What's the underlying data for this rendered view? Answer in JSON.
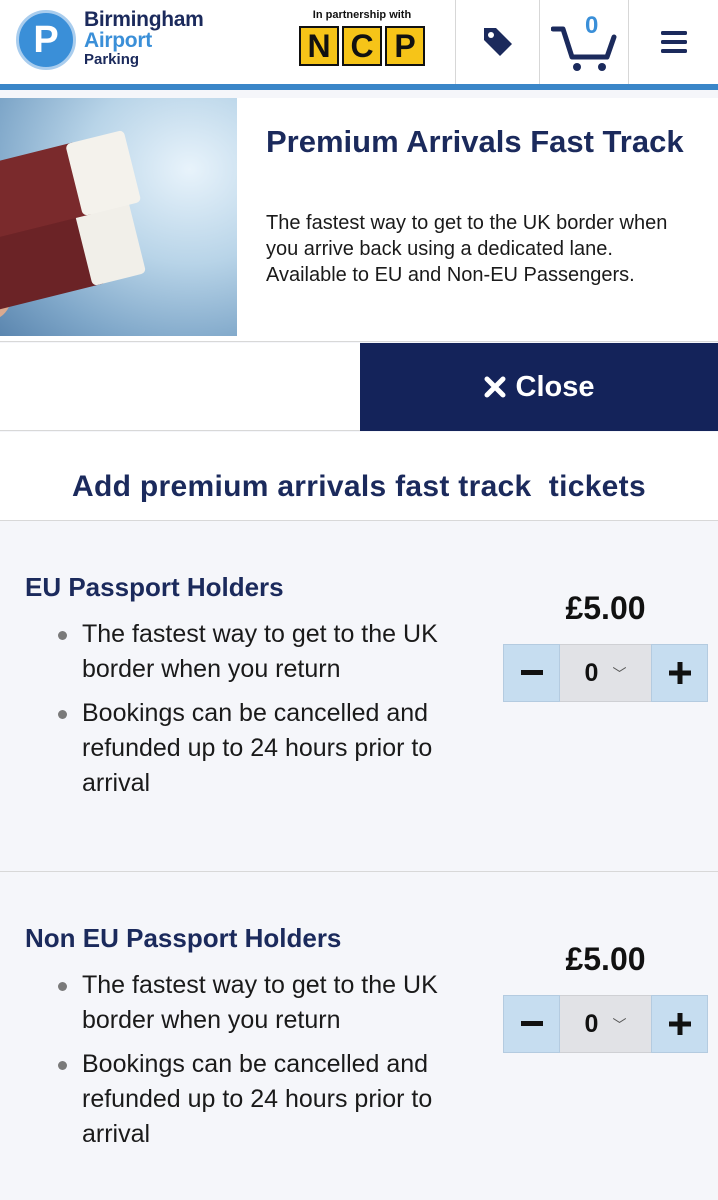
{
  "header": {
    "logo_line1": "Birmingham",
    "logo_line2": "Airport",
    "logo_line3": "Parking",
    "logo_letter": "P",
    "partner_text": "In partnership with",
    "partner_letters": [
      "N",
      "C",
      "P"
    ],
    "cart_count": "0",
    "icons": [
      "tag-icon",
      "cart-icon",
      "menu-icon"
    ]
  },
  "product": {
    "title": "Premium Arrivals Fast Track",
    "description": "The fastest way to get to the UK border when you arrive back using a dedicated lane. Available to EU and Non-EU Passengers."
  },
  "close_button": {
    "icon": "close-icon",
    "label": "Close"
  },
  "add_heading": "Add premium arrivals fast track  tickets",
  "tickets": [
    {
      "title": "EU Passport Holders",
      "bullets": [
        "The fastest way to get to the UK border when you return",
        "Bookings can be cancelled and refunded up to 24 hours prior to arrival"
      ],
      "price": "£5.00",
      "quantity": "0"
    },
    {
      "title": "Non EU Passport Holders",
      "bullets": [
        "The fastest way to get to the UK border when you return",
        "Bookings can be cancelled and refunded up to 24 hours prior to arrival"
      ],
      "price": "£5.00",
      "quantity": "0"
    }
  ],
  "colors": {
    "navy": "#14235a",
    "brand_blue": "#3a8fd8",
    "ncp_yellow": "#f6c418",
    "stepper_blue": "#c6ddf0"
  }
}
